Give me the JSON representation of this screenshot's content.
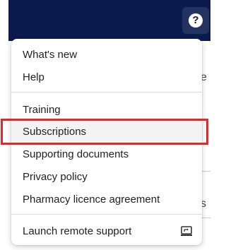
{
  "header": {
    "help_icon": "question-mark-circle-icon",
    "help_glyph": "?"
  },
  "menu": {
    "items": [
      {
        "label": "What's new"
      },
      {
        "label": "Help"
      },
      {
        "label": "Training"
      },
      {
        "label": "Subscriptions"
      },
      {
        "label": "Supporting documents"
      },
      {
        "label": "Privacy policy"
      },
      {
        "label": "Pharmacy licence agreement"
      },
      {
        "label": "Launch remote support",
        "icon": "remote-support-icon"
      }
    ]
  },
  "background": {
    "fragment_1": "e",
    "fragment_2": "s"
  },
  "colors": {
    "header_bg": "#0b1b4d",
    "highlight_border": "#dd2a2a"
  }
}
